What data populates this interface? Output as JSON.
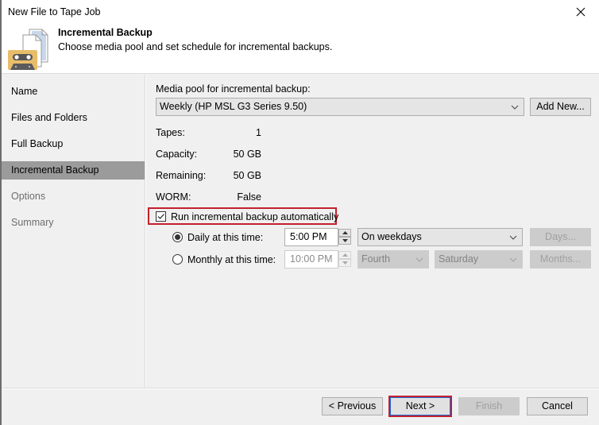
{
  "window": {
    "title": "New File to Tape Job"
  },
  "header": {
    "icon": "tape-files-icon",
    "title": "Incremental Backup",
    "subtitle": "Choose media pool and set schedule for incremental backups."
  },
  "sidebar": {
    "items": [
      {
        "label": "Name",
        "state": "done"
      },
      {
        "label": "Files and Folders",
        "state": "done"
      },
      {
        "label": "Full Backup",
        "state": "done"
      },
      {
        "label": "Incremental Backup",
        "state": "active"
      },
      {
        "label": "Options",
        "state": "pending"
      },
      {
        "label": "Summary",
        "state": "pending"
      }
    ]
  },
  "content": {
    "media_pool_label": "Media pool for incremental backup:",
    "media_pool_value": "Weekly (HP MSL G3 Series 9.50)",
    "add_new_label": "Add New...",
    "info": [
      {
        "label": "Tapes:",
        "value": "1"
      },
      {
        "label": "Capacity:",
        "value": "50 GB"
      },
      {
        "label": "Remaining:",
        "value": "50 GB"
      },
      {
        "label": "WORM:",
        "value": "False"
      }
    ],
    "run_auto_label": "Run incremental backup automatically",
    "run_auto_checked": true,
    "daily": {
      "label": "Daily at this time:",
      "selected": true,
      "time": "5:00 PM",
      "days_option": "On weekdays",
      "days_button": "Days..."
    },
    "monthly": {
      "label": "Monthly at this time:",
      "selected": false,
      "time": "10:00 PM",
      "week_option": "Fourth",
      "day_option": "Saturday",
      "months_button": "Months..."
    }
  },
  "footer": {
    "previous_label": "< Previous",
    "next_label": "Next >",
    "finish_label": "Finish",
    "cancel_label": "Cancel"
  },
  "colors": {
    "highlight_box": "#c4202e",
    "active_nav": "#9b9b9b",
    "window_bg": "#f0f0f0"
  }
}
